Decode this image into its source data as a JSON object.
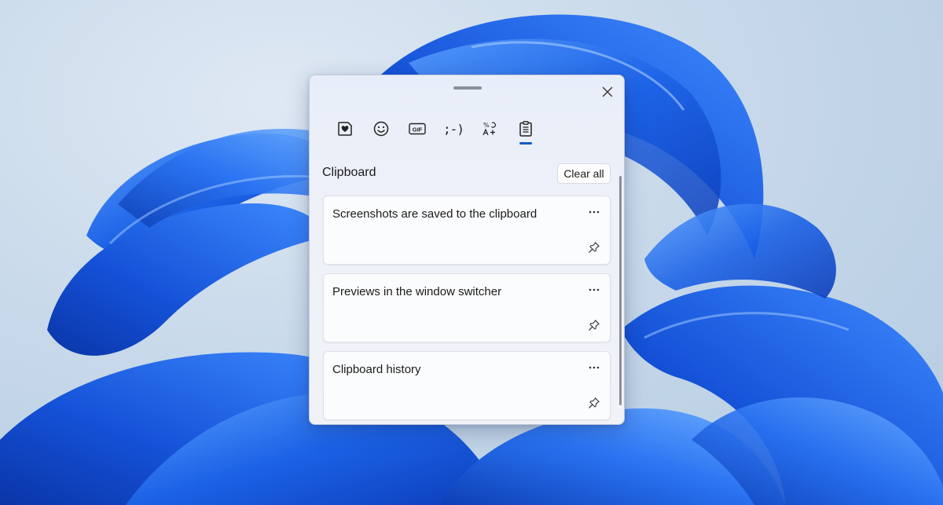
{
  "panel": {
    "tabs": [
      {
        "icon": "heart-sticker-icon"
      },
      {
        "icon": "emoji-icon"
      },
      {
        "icon": "gif-icon",
        "label": "GIF"
      },
      {
        "icon": "kaomoji-icon",
        "label": ";-)"
      },
      {
        "icon": "symbols-icon"
      },
      {
        "icon": "clipboard-icon",
        "active": true
      }
    ],
    "section_title": "Clipboard",
    "clear_all_label": "Clear all",
    "items": [
      {
        "text": "Screenshots are saved to the clipboard"
      },
      {
        "text": "Previews in the window switcher"
      },
      {
        "text": "Clipboard history"
      }
    ]
  },
  "colors": {
    "accent": "#0f5cc0",
    "wallpaper_blue": "#1a5fe0"
  }
}
